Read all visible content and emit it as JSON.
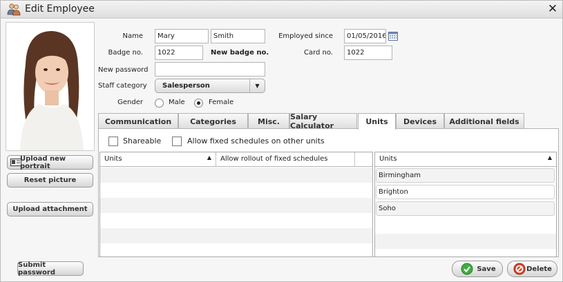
{
  "window": {
    "title": "Edit Employee"
  },
  "left_panel": {
    "upload_portrait": "Upload new portrait",
    "reset_picture": "Reset picture",
    "upload_attachment": "Upload attachment",
    "submit_password": "Submit password"
  },
  "form": {
    "name_label": "Name",
    "first_name": "Mary",
    "last_name": "Smith",
    "employed_label": "Employed since",
    "employed_value": "01/05/2016",
    "badge_label": "Badge no.",
    "badge_value": "1022",
    "new_badge_label": "New badge no.",
    "card_label": "Card no.",
    "card_value": "1022",
    "password_label": "New password",
    "password_value": "",
    "staff_label": "Staff category",
    "staff_value": "Salesperson",
    "gender_label": "Gender",
    "gender_male": "Male",
    "gender_female": "Female",
    "gender_selected": "Female"
  },
  "tabs": [
    {
      "label": "Communication"
    },
    {
      "label": "Categories"
    },
    {
      "label": "Misc."
    },
    {
      "label": "Salary Calculator"
    },
    {
      "label": "Units",
      "active": true
    },
    {
      "label": "Devices"
    },
    {
      "label": "Additional fields"
    }
  ],
  "units_tab": {
    "shareable_label": "Shareable",
    "allow_fixed_label": "Allow fixed schedules on other units",
    "left_grid": {
      "col_units": "Units",
      "col_rollout": "Allow rollout of fixed schedules"
    },
    "right_grid": {
      "col_units": "Units",
      "items": [
        "Birmingham",
        "Brighton",
        "Soho"
      ]
    }
  },
  "footer": {
    "save": "Save",
    "delete": "Delete"
  },
  "colors": {
    "save_icon": "#3fae3f",
    "delete_icon": "#d8462c"
  },
  "icons": [
    "users-icon",
    "close-icon",
    "calendar-icon",
    "id-card-icon",
    "checkmark-icon",
    "no-entry-icon",
    "sort-asc-icon",
    "dropdown-arrow-icon"
  ]
}
